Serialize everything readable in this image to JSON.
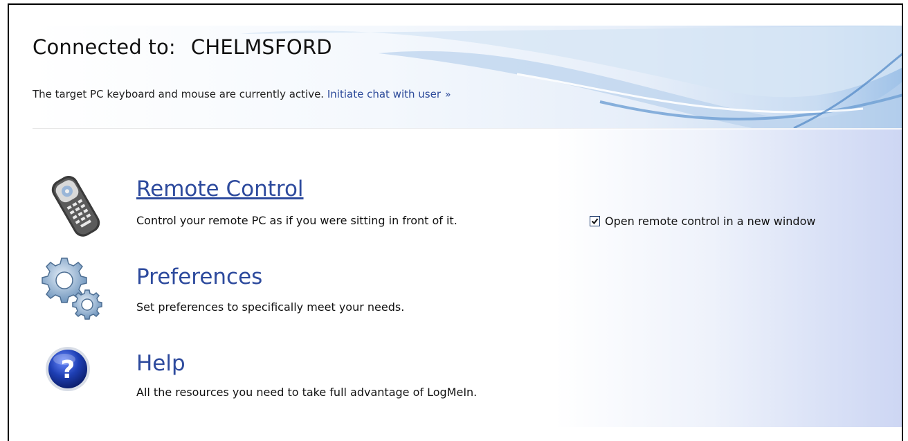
{
  "header": {
    "connected_label": "Connected to:",
    "computer_name": "CHELMSFORD",
    "status_text": "The target PC keyboard and mouse are currently active.",
    "chat_link": "Initiate chat with user",
    "chat_link_suffix": "»"
  },
  "items": [
    {
      "title": "Remote Control",
      "description": "Control your remote PC as if you were sitting in front of it.",
      "icon": "remote-control-icon"
    },
    {
      "title": "Preferences",
      "description": "Set preferences to specifically meet your needs.",
      "icon": "gears-icon"
    },
    {
      "title": "Help",
      "description": "All the resources you need to take full advantage of LogMeIn.",
      "icon": "help-icon"
    }
  ],
  "options": {
    "new_window_label": "Open remote control in a new window",
    "new_window_checked": true
  },
  "colors": {
    "link": "#2d4a9d",
    "banner_blue": "#9fc2e8"
  }
}
